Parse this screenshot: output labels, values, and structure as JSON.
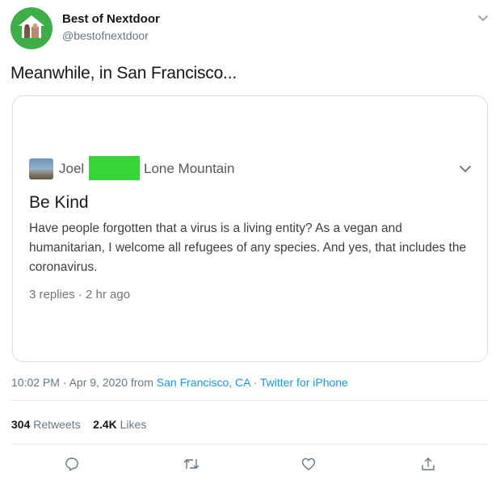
{
  "author": {
    "name": "Best of Nextdoor",
    "handle": "@bestofnextdoor"
  },
  "tweet_text": "Meanwhile, in San Francisco...",
  "embedded_post": {
    "author_first_name": "Joel",
    "location": "Lone Mountain",
    "title": "Be Kind",
    "body": "Have people forgotten that a virus is a living entity?  As a vegan and humanitarian, I welcome all refugees of any species.  And yes, that includes the coronavirus.",
    "meta": "3 replies · 2 hr ago"
  },
  "timestamp": {
    "time_date": "10:02 PM · Apr 9, 2020 from ",
    "location_link": "San Francisco, CA",
    "separator": " · ",
    "source_link": "Twitter for iPhone"
  },
  "stats": {
    "retweets_count": "304",
    "retweets_label": "Retweets",
    "likes_count": "2.4K",
    "likes_label": "Likes"
  },
  "icons": {
    "actions": [
      "reply-icon",
      "retweet-icon",
      "like-icon",
      "share-icon"
    ],
    "menu": "chevron-down-icon"
  },
  "colors": {
    "link": "#1b95e0",
    "avatar_bg": "#3fae49",
    "redaction": "#39d63a",
    "secondary_text": "#657786"
  }
}
